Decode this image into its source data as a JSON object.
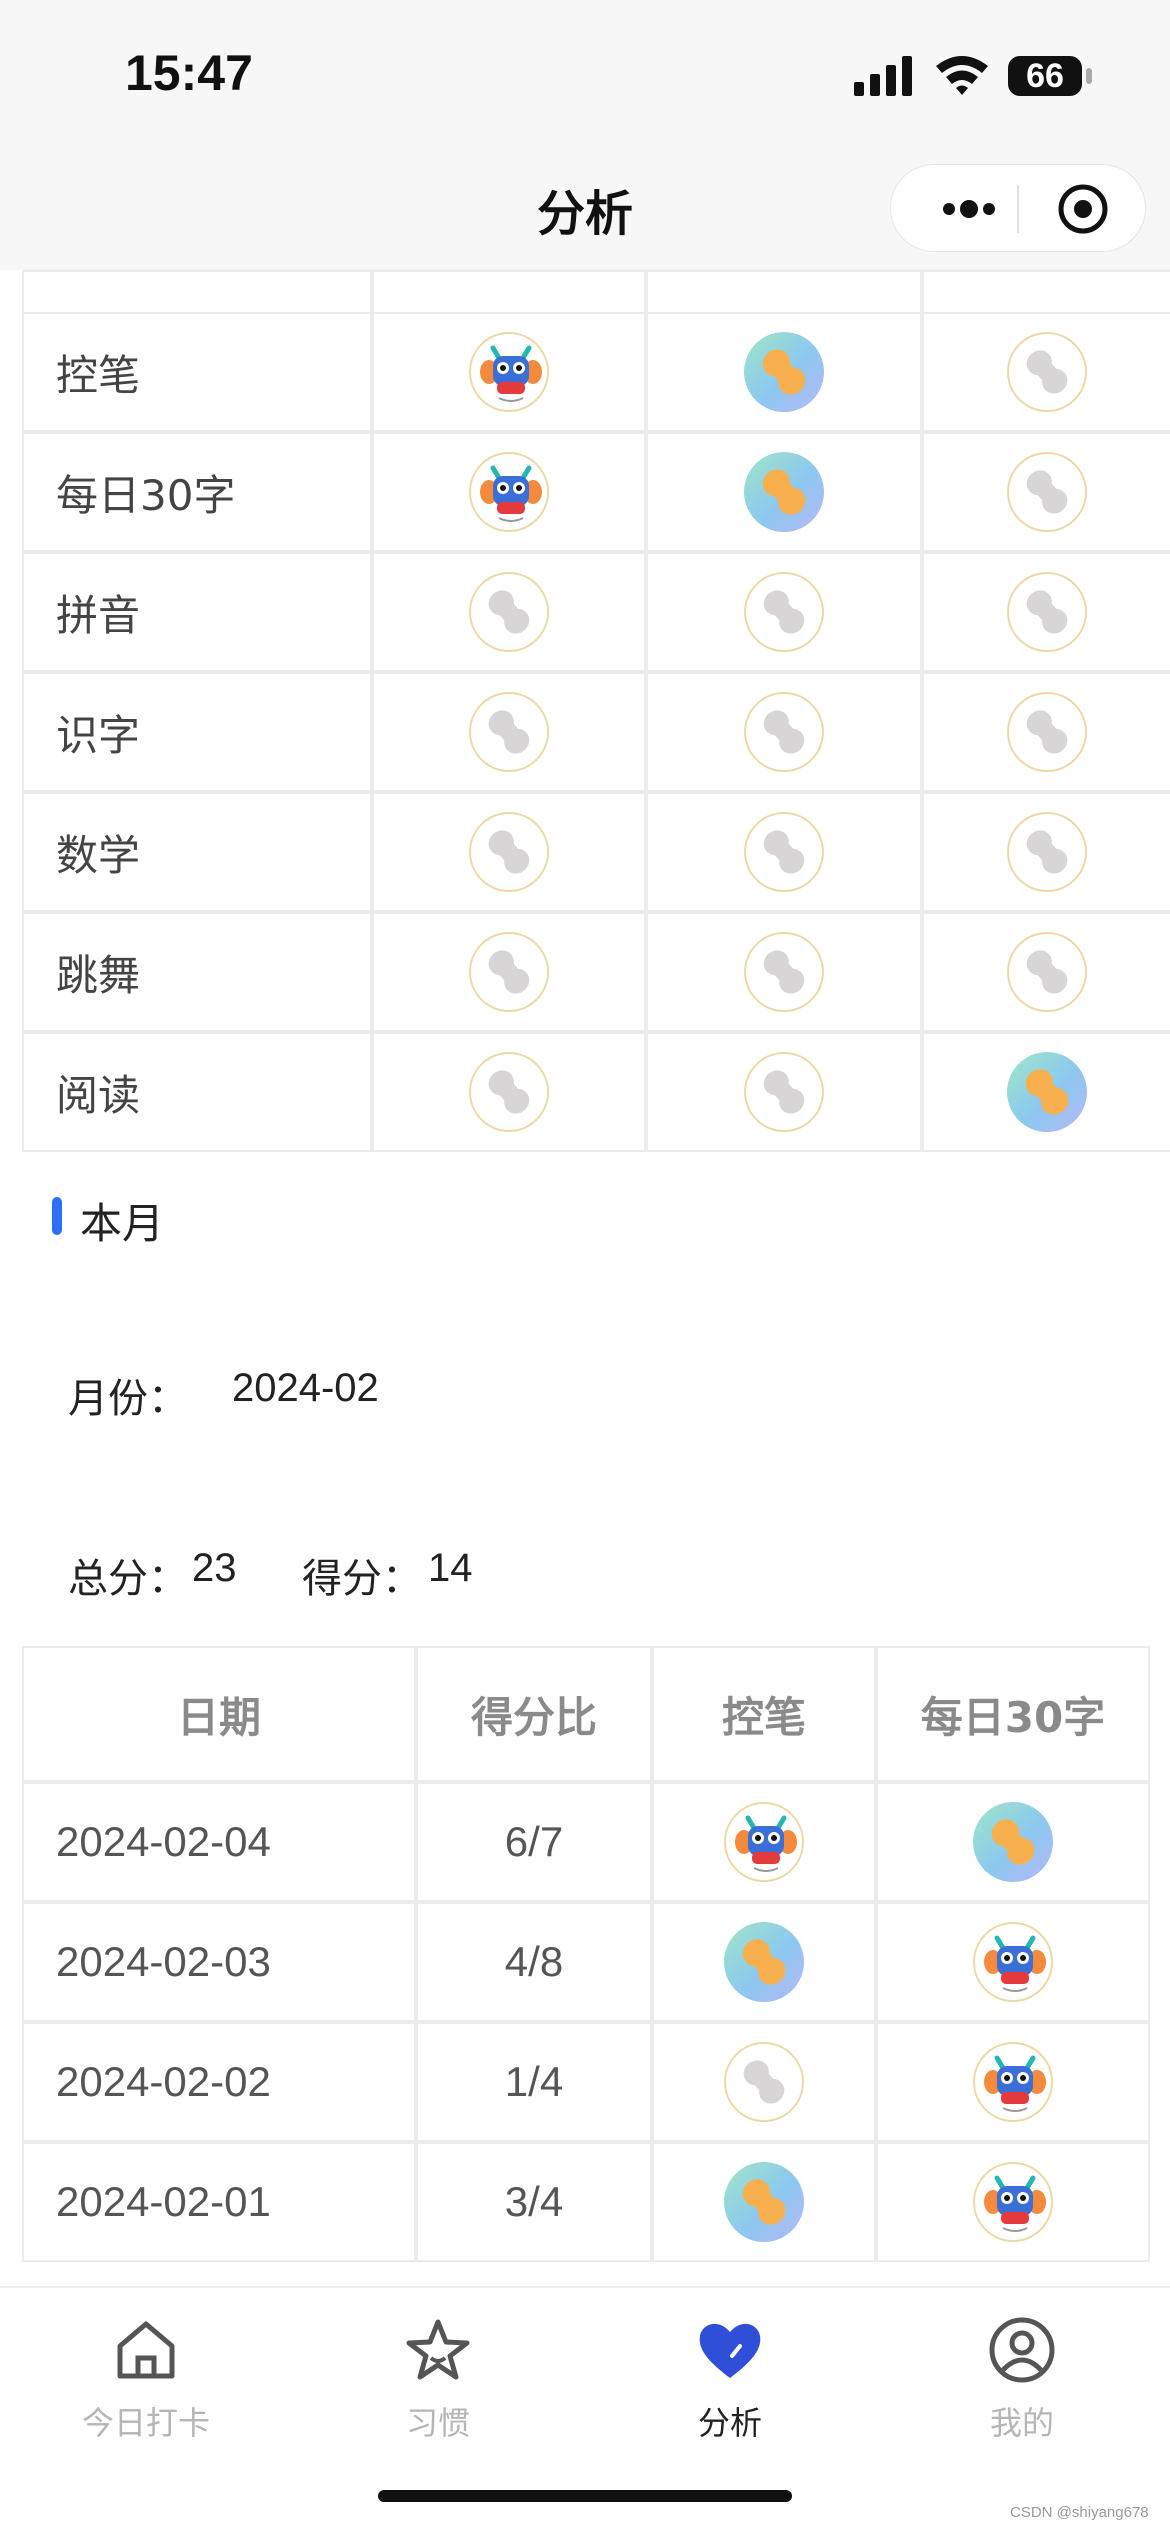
{
  "status_bar": {
    "time": "15:47",
    "battery": "66"
  },
  "nav": {
    "title": "分析"
  },
  "habit_table": {
    "rows": [
      {
        "label": "控笔",
        "badges": [
          "dragon",
          "blue",
          "gray"
        ]
      },
      {
        "label": "每日30字",
        "badges": [
          "dragon",
          "blue",
          "gray"
        ]
      },
      {
        "label": "拼音",
        "badges": [
          "gray",
          "gray",
          "gray"
        ]
      },
      {
        "label": "识字",
        "badges": [
          "gray",
          "gray",
          "gray"
        ]
      },
      {
        "label": "数学",
        "badges": [
          "gray",
          "gray",
          "gray"
        ]
      },
      {
        "label": "跳舞",
        "badges": [
          "gray",
          "gray",
          "gray"
        ]
      },
      {
        "label": "阅读",
        "badges": [
          "gray",
          "gray",
          "blue"
        ]
      }
    ]
  },
  "month_section": {
    "title": "本月",
    "month_label": "月份：",
    "month_value": "2024-02",
    "total_label": "总分：",
    "total_value": "23",
    "score_label": "得分：",
    "score_value": "14"
  },
  "month_table": {
    "headers": [
      "日期",
      "得分比",
      "控笔",
      "每日30字"
    ],
    "rows": [
      {
        "date": "2024-02-04",
        "ratio": "6/7",
        "badges": [
          "dragon",
          "blue"
        ]
      },
      {
        "date": "2024-02-03",
        "ratio": "4/8",
        "badges": [
          "blue",
          "dragon"
        ]
      },
      {
        "date": "2024-02-02",
        "ratio": "1/4",
        "badges": [
          "gray",
          "dragon"
        ]
      },
      {
        "date": "2024-02-01",
        "ratio": "3/4",
        "badges": [
          "blue",
          "dragon"
        ]
      }
    ]
  },
  "tab_bar": {
    "tabs": [
      {
        "label": "今日打卡",
        "icon": "home-icon",
        "active": false
      },
      {
        "label": "习惯",
        "icon": "star-icon",
        "active": false
      },
      {
        "label": "分析",
        "icon": "heart-icon",
        "active": true
      },
      {
        "label": "我的",
        "icon": "user-icon",
        "active": false
      }
    ],
    "active_color": "#2f4fd8",
    "inactive_color": "#b5b5b5"
  },
  "watermark": "CSDN @shiyang678",
  "colors": {
    "accent": "#2f6ff5",
    "badge_border": "#ead9a4"
  }
}
